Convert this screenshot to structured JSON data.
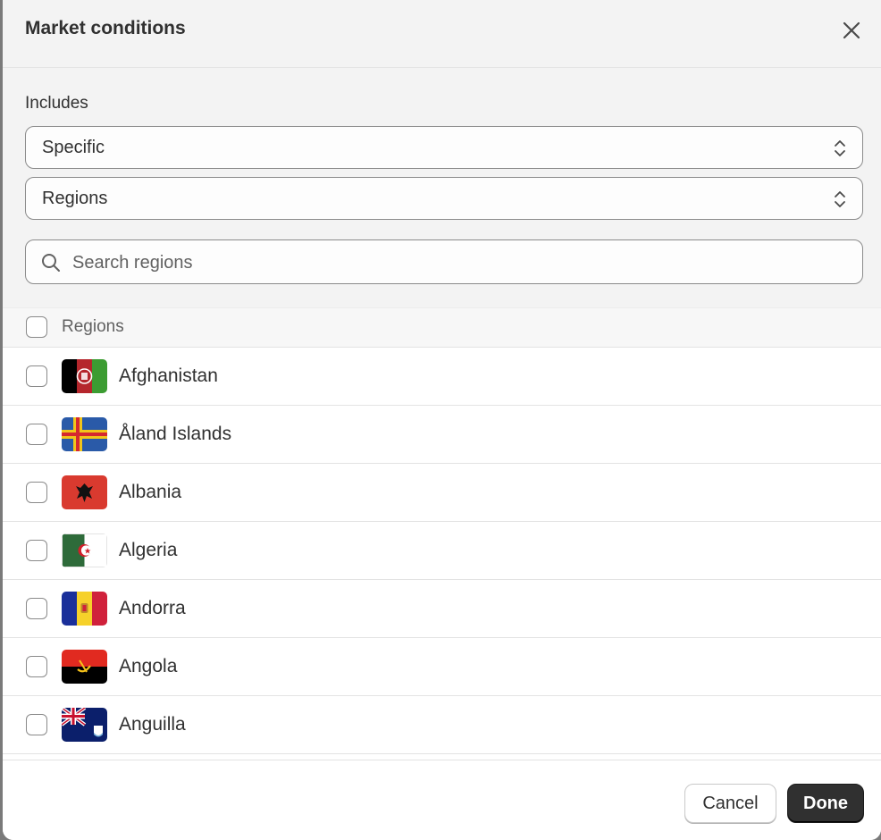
{
  "modal": {
    "title": "Market conditions"
  },
  "includes": {
    "label": "Includes",
    "scope_value": "Specific",
    "type_value": "Regions"
  },
  "search": {
    "placeholder": "Search regions"
  },
  "list": {
    "header_label": "Regions",
    "rows": [
      {
        "name": "Afghanistan",
        "flag_icon": "afghanistan-flag-icon"
      },
      {
        "name": "Åland Islands",
        "flag_icon": "aland-islands-flag-icon"
      },
      {
        "name": "Albania",
        "flag_icon": "albania-flag-icon"
      },
      {
        "name": "Algeria",
        "flag_icon": "algeria-flag-icon"
      },
      {
        "name": "Andorra",
        "flag_icon": "andorra-flag-icon"
      },
      {
        "name": "Angola",
        "flag_icon": "angola-flag-icon"
      },
      {
        "name": "Anguilla",
        "flag_icon": "anguilla-flag-icon"
      }
    ]
  },
  "footer": {
    "cancel_label": "Cancel",
    "done_label": "Done"
  },
  "colors": {
    "primary_button": "#303030",
    "panel_bg": "#f3f3f3"
  }
}
